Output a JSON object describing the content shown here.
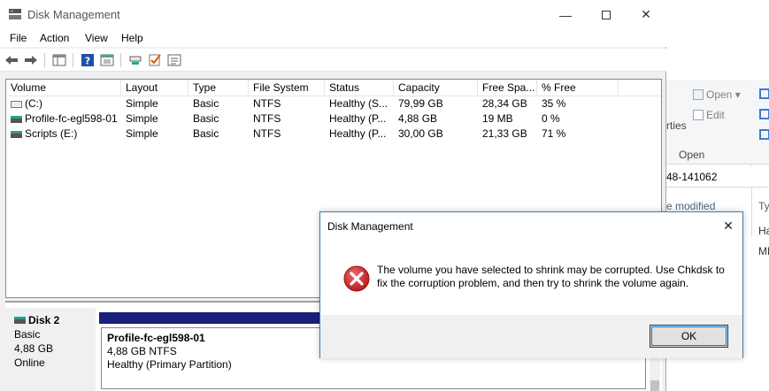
{
  "window": {
    "title": "Disk Management",
    "minimize_icon": "minimize-icon",
    "maximize_icon": "maximize-icon",
    "close_icon": "close-icon"
  },
  "menu": [
    "File",
    "Action",
    "View",
    "Help"
  ],
  "toolbar_icons": [
    "back-arrow-icon",
    "forward-arrow-icon",
    "console-tree-icon",
    "help-icon",
    "properties-icon",
    "connect-icon",
    "checkmark-icon",
    "list-icon"
  ],
  "volume_table": {
    "headers": [
      "Volume",
      "Layout",
      "Type",
      "File System",
      "Status",
      "Capacity",
      "Free Spa...",
      "% Free"
    ],
    "rows": [
      [
        "(C:)",
        "Simple",
        "Basic",
        "NTFS",
        "Healthy (S...",
        "79,99 GB",
        "28,34 GB",
        "35 %"
      ],
      [
        "Profile-fc-egl598-01",
        "Simple",
        "Basic",
        "NTFS",
        "Healthy (P...",
        "4,88 GB",
        "19 MB",
        "0 %"
      ],
      [
        "Scripts (E:)",
        "Simple",
        "Basic",
        "NTFS",
        "Healthy (P...",
        "30,00 GB",
        "21,33 GB",
        "71 %"
      ]
    ]
  },
  "disk": {
    "name": "Disk 2",
    "type": "Basic",
    "size": "4,88 GB",
    "status": "Online",
    "partition": {
      "name": "Profile-fc-egl598-01",
      "size": "4,88 GB NTFS",
      "status": "Healthy (Primary Partition)"
    }
  },
  "dialog": {
    "title": "Disk Management",
    "message": "The volume you have selected to shrink may be corrupted. Use Chkdsk to fix the corruption problem, and then try to shrink the volume again.",
    "ok_label": "OK",
    "icon": "error-icon"
  },
  "background_explorer": {
    "open_label": "Open",
    "edit_label": "Edit",
    "open_group_label": "Open",
    "properties_fragment": "rties",
    "address_fragment": "48-141062",
    "column_fragment": "e modified",
    "type_fragment": "Typ",
    "row1_fragment": "Ha",
    "row2_fragment": "MB"
  },
  "colors": {
    "partition_bar": "#1a1f7a",
    "dialog_border": "#3c7fb1",
    "error_red": "#d32f2f",
    "focus_blue": "#0078d7"
  }
}
